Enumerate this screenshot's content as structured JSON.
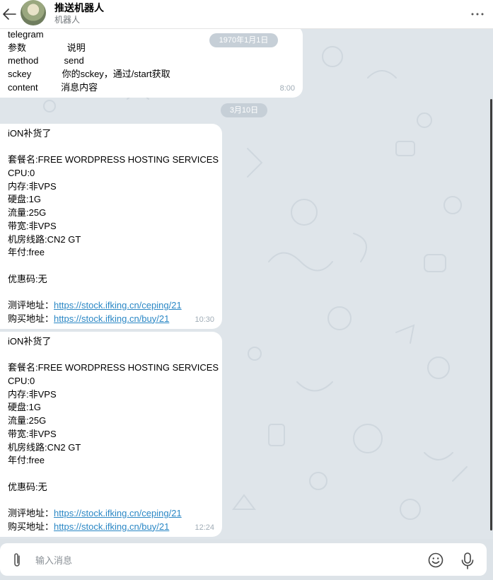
{
  "header": {
    "title": "推送机器人",
    "subtitle": "机器人",
    "icons": {
      "back": "arrow-left-icon",
      "more": "more-dots-icon"
    }
  },
  "messages": [
    {
      "date_pill": "1970年1月1日",
      "lines": [
        "telegram",
        "参数                说明",
        "method          send",
        "sckey            你的sckey，通过/start获取",
        "content         消息内容"
      ],
      "time": "8:00"
    }
  ],
  "date_separator": "3月10日",
  "posts": [
    {
      "lines": [
        "iON补货了",
        "",
        "套餐名:FREE WORDPRESS HOSTING SERVICES",
        "CPU:0",
        "内存:非VPS",
        "硬盘:1G",
        "流量:25G",
        "带宽:非VPS",
        "机房线路:CN2 GT",
        "年付:free",
        "",
        "优惠码:无",
        ""
      ],
      "review_label": "测评地址：",
      "review_link": "https://stock.ifking.cn/ceping/21",
      "buy_label": "购买地址：",
      "buy_link": "https://stock.ifking.cn/buy/21",
      "time": "10:30"
    },
    {
      "lines": [
        "iON补货了",
        "",
        "套餐名:FREE WORDPRESS HOSTING SERVICES",
        "CPU:0",
        "内存:非VPS",
        "硬盘:1G",
        "流量:25G",
        "带宽:非VPS",
        "机房线路:CN2 GT",
        "年付:free",
        "",
        "优惠码:无",
        ""
      ],
      "review_label": "测评地址：",
      "review_link": "https://stock.ifking.cn/ceping/21",
      "buy_label": "购买地址：",
      "buy_link": "https://stock.ifking.cn/buy/21",
      "time": "12:24"
    }
  ],
  "composer": {
    "placeholder": "输入消息",
    "icons": {
      "attach": "paperclip-icon",
      "emoji": "emoji-icon",
      "mic": "microphone-icon"
    }
  },
  "colors": {
    "link": "#2a87c5",
    "time": "#a0acb6",
    "pill": "#c6cfd7",
    "wallpaper": "#dfe5ea"
  }
}
